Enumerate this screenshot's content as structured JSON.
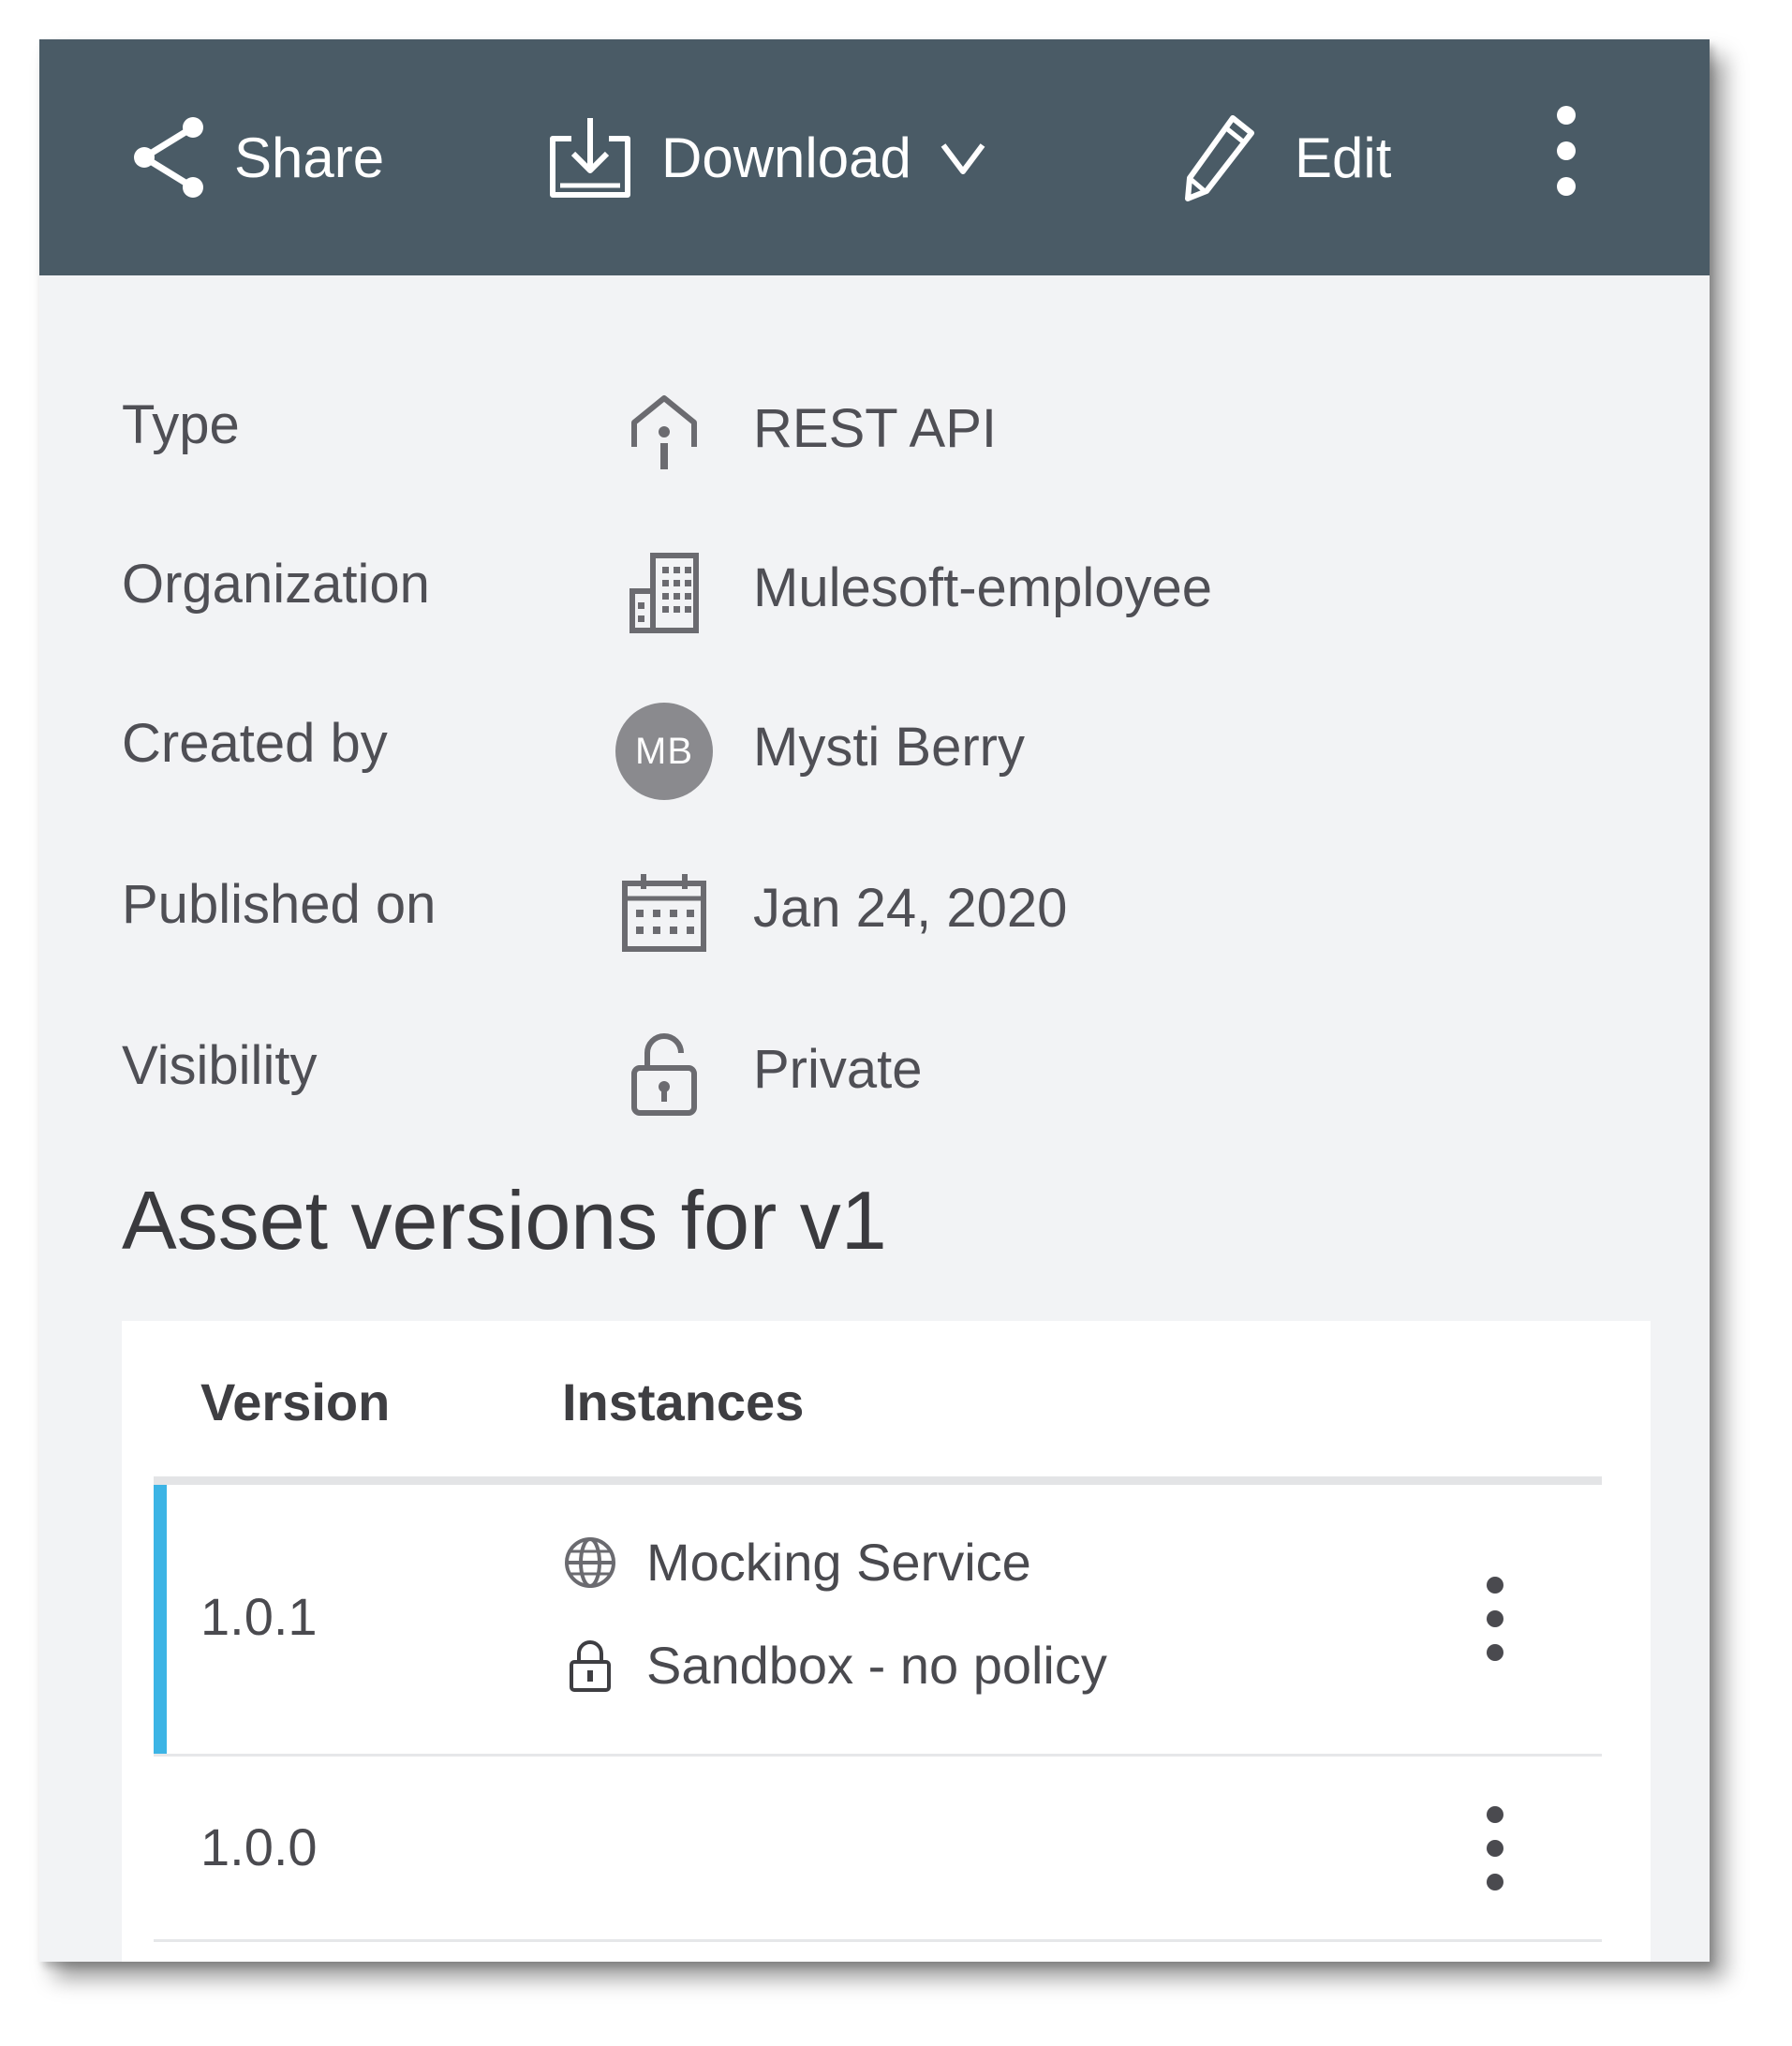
{
  "toolbar": {
    "share_label": "Share",
    "share_icon": "share-icon",
    "download_label": "Download",
    "download_icon": "download-icon",
    "edit_label": "Edit",
    "edit_icon": "pencil-icon",
    "more_icon": "vertical-ellipsis-icon",
    "background_color": "#4a5b66"
  },
  "details": [
    {
      "label": "Type",
      "value": "REST API",
      "icon": "api-icon"
    },
    {
      "label": "Organization",
      "value": "Mulesoft-employee",
      "icon": "building-icon"
    },
    {
      "label": "Created by",
      "value": "Mysti Berry",
      "icon": "avatar",
      "avatar_initials": "MB"
    },
    {
      "label": "Published on",
      "value": "Jan 24, 2020",
      "icon": "calendar-icon"
    },
    {
      "label": "Visibility",
      "value": "Private",
      "icon": "lock-icon"
    }
  ],
  "versions_section": {
    "title": "Asset versions for v1",
    "columns": [
      "Version",
      "Instances"
    ],
    "rows": [
      {
        "version": "1.0.1",
        "selected": true,
        "instances": [
          {
            "label": "Mocking Service",
            "icon": "globe-icon"
          },
          {
            "label": "Sandbox - no policy",
            "icon": "lock-icon"
          }
        ]
      },
      {
        "version": "1.0.0",
        "selected": false,
        "instances": []
      }
    ],
    "accent_color": "#3cb4e5"
  }
}
